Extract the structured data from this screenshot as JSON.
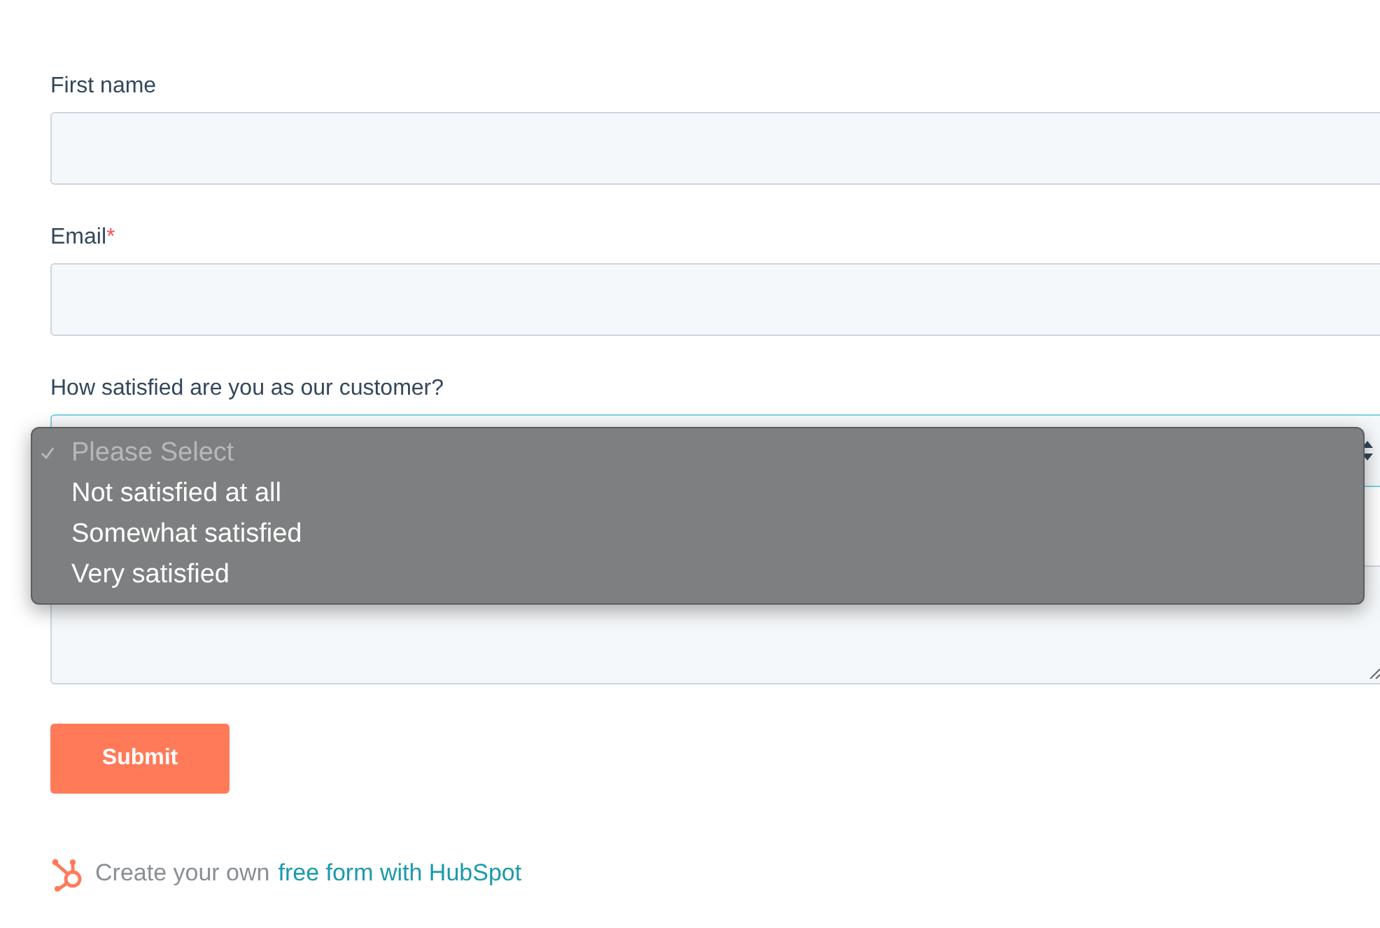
{
  "fields": [
    {
      "kind": "text",
      "label": "First name"
    },
    {
      "kind": "text",
      "label": "Email",
      "required_mark": "*"
    },
    {
      "kind": "select",
      "label": "How satisfied are you as our customer?",
      "expanded": true,
      "options": [
        {
          "label": "Please Select",
          "selected": true,
          "disabled": true
        },
        {
          "label": "Not satisfied at all",
          "selected": false,
          "disabled": false
        },
        {
          "label": "Somewhat satisfied",
          "selected": false,
          "disabled": false
        },
        {
          "label": "Very satisfied",
          "selected": false,
          "disabled": false
        }
      ]
    },
    {
      "kind": "textarea"
    }
  ],
  "submit": "Submit",
  "footer": {
    "text": "Create your own",
    "link": "free form with HubSpot"
  }
}
